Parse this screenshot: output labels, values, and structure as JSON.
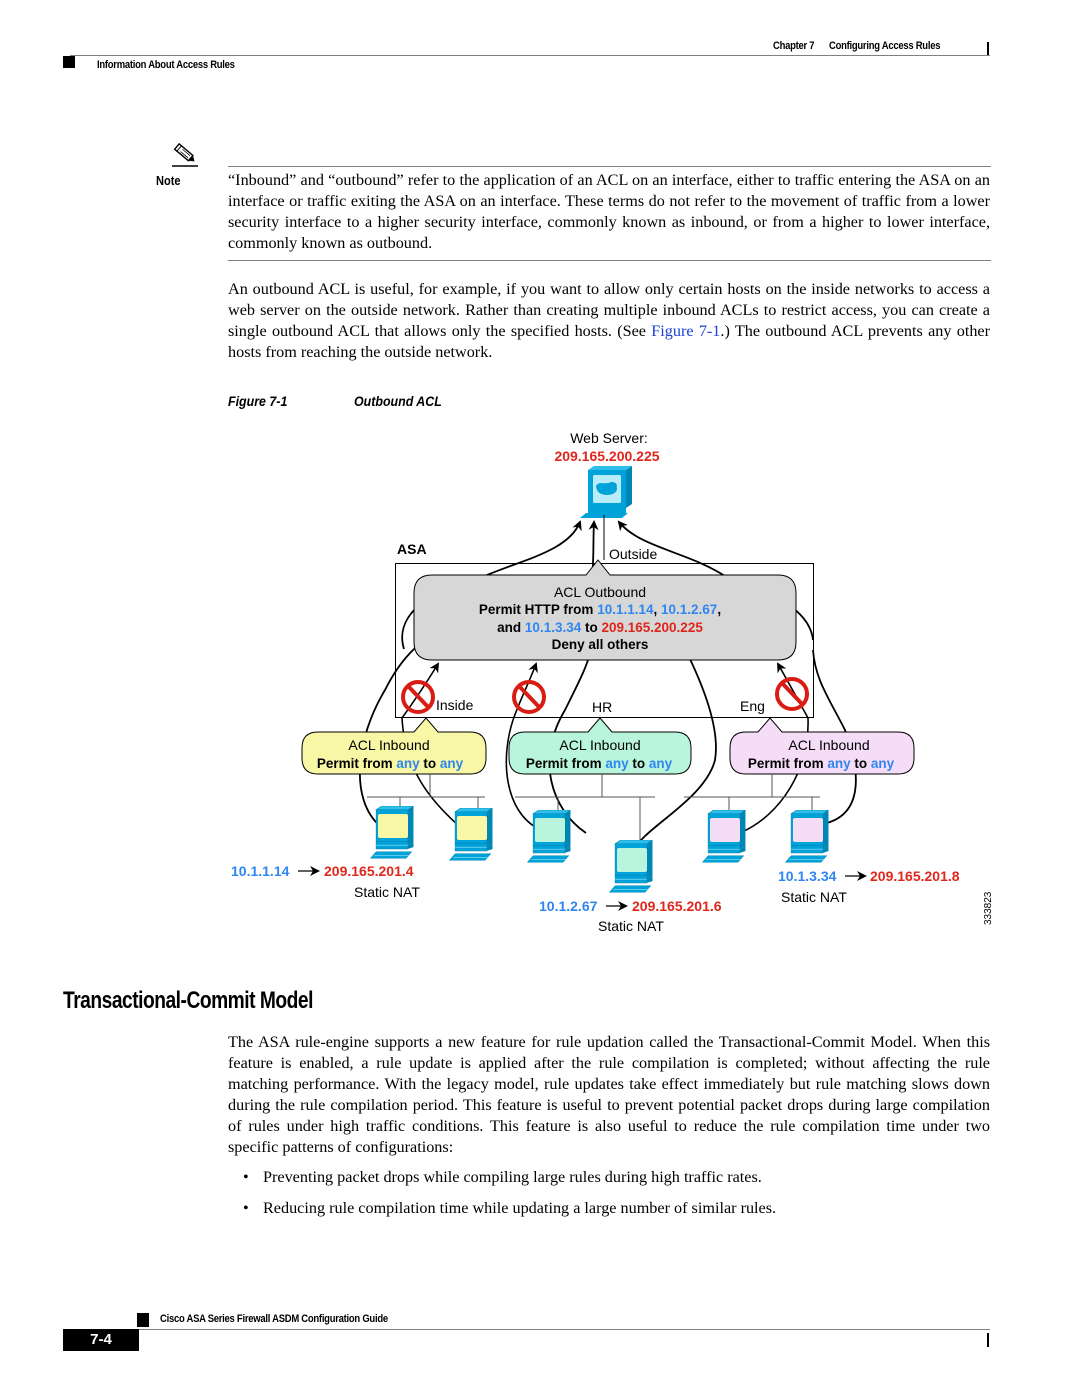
{
  "header": {
    "chapter": "Chapter 7",
    "chapter_title": "Configuring Access Rules",
    "section": "Information About Access Rules"
  },
  "note": {
    "icon": "pencil-icon",
    "label": "Note",
    "text": "“Inbound” and “outbound” refer to the application of an ACL on an interface, either to traffic entering the ASA on an interface or traffic exiting the ASA on an interface. These terms do not refer to the movement of traffic from a lower security interface to a higher security interface, commonly known as inbound, or from a higher to lower interface, commonly known as outbound."
  },
  "intro_paragraph": {
    "before_link": "An outbound ACL is useful, for example, if you want to allow only certain hosts on the inside networks to access a web server on the outside network. Rather than creating multiple inbound ACLs to restrict access, you can create a single outbound ACL that allows only the specified hosts. (See ",
    "link": "Figure 7-1",
    "after_link": ".) The outbound ACL prevents any other hosts from reaching the outside network."
  },
  "figure": {
    "number": "Figure 7-1",
    "title": "Outbound ACL",
    "web_server_label": "Web Server:",
    "web_server_ip": "209.165.200.225",
    "asa_label": "ASA",
    "outside_label": "Outside",
    "acl_outbound": {
      "title": "ACL Outbound",
      "line1_prefix": "Permit HTTP from ",
      "ip1": "10.1.1.14",
      "sep1": ", ",
      "ip2": "10.1.2.67",
      "sep2": ",",
      "line2_prefix": "and ",
      "ip3": "10.1.3.34",
      "line2_mid": " to ",
      "dest_ip": "209.165.200.225",
      "line3": "Deny all others"
    },
    "interfaces": [
      {
        "name": "Inside",
        "color": "#f7f7a6"
      },
      {
        "name": "HR",
        "color": "#b9f5dc"
      },
      {
        "name": "Eng",
        "color": "#f5dcf7"
      }
    ],
    "acl_inbound": {
      "title": "ACL Inbound",
      "permit_from": "Permit from ",
      "any1": "any",
      "to": " to ",
      "any2": "any"
    },
    "nat": [
      {
        "inside_ip": "10.1.1.14",
        "outside_ip": "209.165.201.4",
        "label": "Static NAT"
      },
      {
        "inside_ip": "10.1.2.67",
        "outside_ip": "209.165.201.6",
        "label": "Static NAT"
      },
      {
        "inside_ip": "10.1.3.34",
        "outside_ip": "209.165.201.8",
        "label": "Static NAT"
      }
    ],
    "figure_id": "333823",
    "colors": {
      "blue_ip": "#2f86f0",
      "red_ip": "#e0261c",
      "host_blue": "#00a3d9",
      "deny_red": "#d91c14",
      "acl_gray": "#d7d7d7"
    }
  },
  "section": {
    "title": "Transactional-Commit Model",
    "paragraph": "The ASA rule-engine supports a new feature for rule updation called the Transactional-Commit Model. When this feature is enabled, a rule update is applied after the rule compilation is completed; without affecting the rule matching performance. With the legacy model, rule updates take effect immediately but rule matching slows down during the rule compilation period. This feature is useful to prevent potential packet drops during large compilation of rules under high traffic conditions. This feature is also useful to reduce the rule compilation time under two specific patterns of configurations:",
    "bullets": [
      "Preventing packet drops while compiling large rules during high traffic rates.",
      "Reducing rule compilation time while updating a large number of similar rules."
    ]
  },
  "footer": {
    "guide_title": "Cisco ASA Series Firewall ASDM Configuration Guide",
    "page_number": "7-4"
  }
}
